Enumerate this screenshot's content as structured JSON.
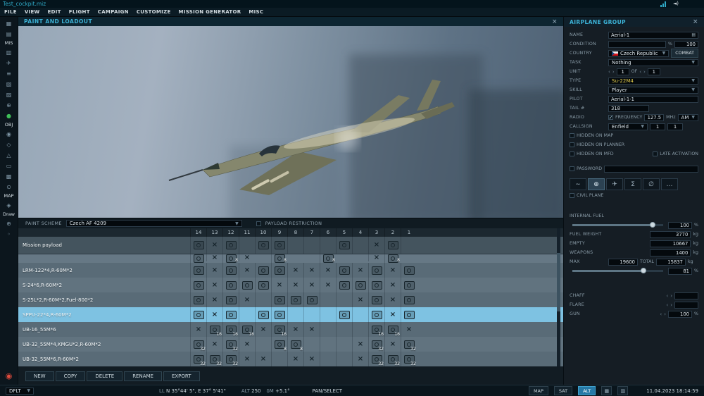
{
  "window": {
    "title": "Test_cockpit.miz"
  },
  "menu": {
    "items": [
      "FILE",
      "VIEW",
      "EDIT",
      "FLIGHT",
      "CAMPAIGN",
      "CUSTOMIZE",
      "MISSION GENERATOR",
      "MISC"
    ]
  },
  "sidebar": {
    "items": [
      {
        "glyph": "▦",
        "name": "open-mission"
      },
      {
        "glyph": "▤",
        "name": "save-mission"
      },
      {
        "label": "MIS"
      },
      {
        "glyph": "▥",
        "name": "briefing"
      },
      {
        "glyph": "✈",
        "name": "aircraft-group"
      },
      {
        "glyph": "≡",
        "name": "mission-options"
      },
      {
        "glyph": "▧",
        "name": "weather"
      },
      {
        "glyph": "▨",
        "name": "rules"
      },
      {
        "glyph": "⊕",
        "name": "add-unit"
      },
      {
        "glyph": "●",
        "color": "green",
        "name": "status"
      },
      {
        "label": "OBJ"
      },
      {
        "glyph": "◉",
        "name": "unit-list"
      },
      {
        "glyph": "◇",
        "name": "static-object"
      },
      {
        "glyph": "△",
        "name": "template"
      },
      {
        "glyph": "▭",
        "name": "trigger-zone"
      },
      {
        "glyph": "▩",
        "name": "grid"
      },
      {
        "glyph": "⊙",
        "name": "circle-tool"
      },
      {
        "label": "MAP"
      },
      {
        "glyph": "◈",
        "name": "map-overlay"
      },
      {
        "label": "Draw"
      },
      {
        "glyph": "⊕",
        "name": "measure-tool"
      },
      {
        "glyph": "◦",
        "name": "misc-tool"
      }
    ],
    "record": {
      "glyph": "◉"
    }
  },
  "paint": {
    "title": "PAINT AND LOADOUT",
    "close": "×",
    "scheme_label": "PAINT SCHEME",
    "scheme_value": "Czech AF 4209",
    "restriction_label": "PAYLOAD RESTRICTION"
  },
  "loadout": {
    "columns": [
      "14",
      "13",
      "12",
      "11",
      "10",
      "9",
      "8",
      "7",
      "6",
      "5",
      "4",
      "3",
      "2",
      "1"
    ],
    "payload_row": {
      "label": "Mission payload",
      "cells": [
        {
          "t": "w"
        },
        {
          "t": "x"
        },
        {
          "t": "w"
        },
        {},
        {
          "t": "w"
        },
        {
          "t": "w"
        },
        {},
        {},
        {},
        {
          "t": "w"
        },
        {},
        {
          "t": "x"
        },
        {
          "t": "w"
        },
        {}
      ]
    },
    "rows": [
      {
        "label": "",
        "clipped": true,
        "cells": [
          {
            "t": "w"
          },
          {
            "t": "x"
          },
          {
            "t": "w",
            "n": "8"
          },
          {
            "t": "x"
          },
          {},
          {
            "t": "w",
            "n": "8"
          },
          {},
          {},
          {
            "t": "w",
            "n": "8"
          },
          {},
          {},
          {
            "t": "x"
          },
          {
            "t": "w",
            "n": "8"
          },
          {}
        ]
      },
      {
        "label": "LRM-122*4,R-60M*2",
        "cells": [
          {
            "t": "w"
          },
          {
            "t": "x"
          },
          {
            "t": "w"
          },
          {
            "t": "x"
          },
          {
            "t": "w"
          },
          {
            "t": "w"
          },
          {
            "t": "x"
          },
          {
            "t": "x"
          },
          {
            "t": "x"
          },
          {
            "t": "w"
          },
          {
            "t": "x"
          },
          {
            "t": "w"
          },
          {
            "t": "x"
          },
          {
            "t": "w"
          }
        ]
      },
      {
        "label": "S-24*6,R-60M*2",
        "cells": [
          {
            "t": "w"
          },
          {
            "t": "x"
          },
          {
            "t": "w"
          },
          {
            "t": "w"
          },
          {
            "t": "w"
          },
          {
            "t": "x"
          },
          {
            "t": "x"
          },
          {
            "t": "x"
          },
          {
            "t": "x"
          },
          {
            "t": "w"
          },
          {
            "t": "w"
          },
          {
            "t": "w"
          },
          {
            "t": "x"
          },
          {
            "t": "w"
          }
        ]
      },
      {
        "label": "S-25L*2,R-60M*2,Fuel-800*2",
        "cells": [
          {
            "t": "w"
          },
          {
            "t": "x"
          },
          {
            "t": "w"
          },
          {
            "t": "x"
          },
          {},
          {
            "t": "w"
          },
          {
            "t": "w"
          },
          {
            "t": "w"
          },
          {},
          {},
          {
            "t": "x"
          },
          {
            "t": "w"
          },
          {
            "t": "x"
          },
          {
            "t": "w"
          }
        ]
      },
      {
        "label": "SPPU-22*4,R-60M*2",
        "selected": true,
        "cells": [
          {
            "t": "w"
          },
          {
            "t": "x"
          },
          {
            "t": "w"
          },
          {},
          {
            "t": "w"
          },
          {
            "t": "w"
          },
          {},
          {},
          {},
          {
            "t": "w"
          },
          {},
          {
            "t": "w"
          },
          {
            "t": "x"
          },
          {
            "t": "w"
          }
        ]
      },
      {
        "label": "UB-16_55M*6",
        "cells": [
          {
            "t": "x"
          },
          {
            "t": "w",
            "n": "16"
          },
          {
            "t": "w",
            "n": "16"
          },
          {
            "t": "w",
            "n": "16"
          },
          {
            "t": "x"
          },
          {
            "t": "w",
            "n": "16"
          },
          {
            "t": "x"
          },
          {
            "t": "x"
          },
          {},
          {},
          {},
          {
            "t": "w",
            "n": "16"
          },
          {
            "t": "w",
            "n": "16"
          },
          {
            "t": "x"
          }
        ]
      },
      {
        "label": "UB-32_55M*4,KMGU*2,R-60M*2",
        "cells": [
          {
            "t": "w",
            "n": "32"
          },
          {
            "t": "x"
          },
          {
            "t": "w",
            "n": "32"
          },
          {
            "t": "x"
          },
          {},
          {
            "t": "w",
            "n": "8"
          },
          {
            "t": "w",
            "n": "8"
          },
          {},
          {},
          {},
          {
            "t": "x"
          },
          {
            "t": "w",
            "n": "32"
          },
          {
            "t": "x"
          },
          {
            "t": "w",
            "n": "32"
          }
        ]
      },
      {
        "label": "UB-32_55M*6,R-60M*2",
        "cells": [
          {
            "t": "w",
            "n": "32"
          },
          {
            "t": "w",
            "n": "32"
          },
          {
            "t": "w",
            "n": "32"
          },
          {
            "t": "x"
          },
          {
            "t": "x"
          },
          {},
          {
            "t": "x"
          },
          {
            "t": "x"
          },
          {},
          {},
          {
            "t": "x"
          },
          {
            "t": "w",
            "n": "32"
          },
          {
            "t": "w",
            "n": "32"
          },
          {
            "t": "w",
            "n": "32"
          }
        ]
      }
    ],
    "buttons": [
      "NEW",
      "COPY",
      "DELETE",
      "RENAME",
      "EXPORT"
    ]
  },
  "group": {
    "title": "AIRPLANE GROUP",
    "close": "×",
    "rows": {
      "name": {
        "label": "NAME",
        "value": "Aerial-1"
      },
      "condition": {
        "label": "CONDITION",
        "pct": "%",
        "value": "100"
      },
      "country": {
        "label": "COUNTRY",
        "value": "Czech Republic",
        "combat": "COMBAT"
      },
      "task": {
        "label": "TASK",
        "value": "Nothing"
      },
      "unit": {
        "label": "UNIT",
        "value": "1",
        "of": "OF",
        "total": "1"
      },
      "type": {
        "label": "TYPE",
        "value": "Su-22M4"
      },
      "skill": {
        "label": "SKILL",
        "value": "Player"
      },
      "pilot": {
        "label": "PILOT",
        "value": "Aerial-1-1"
      },
      "tail": {
        "label": "TAIL #",
        "value": "318"
      },
      "radio": {
        "label": "RADIO",
        "freq_label": "FREQUENCY",
        "freq": "127.5",
        "unit": "MHz",
        "mod": "AM"
      },
      "callsign": {
        "label": "CALLSIGN",
        "value": "Enfield",
        "n1": "1",
        "n2": "1"
      },
      "hidden_map": "HIDDEN ON MAP",
      "hidden_planner": "HIDDEN ON PLANNER",
      "hidden_mfd": "HIDDEN ON MFD",
      "late_activation": "LATE ACTIVATION",
      "password": "PASSWORD",
      "civil": "CIVIL PLANE"
    },
    "tabs": [
      {
        "glyph": "∼",
        "name": "route-tab"
      },
      {
        "glyph": "⊕",
        "name": "loadout-tab",
        "active": true
      },
      {
        "glyph": "✈",
        "name": "aircraft-tab"
      },
      {
        "glyph": "Σ",
        "name": "summary-tab"
      },
      {
        "glyph": "∅",
        "name": "failures-tab"
      },
      {
        "glyph": "…",
        "name": "more-tab"
      }
    ],
    "fuel": {
      "internal_label": "INTERNAL FUEL",
      "internal_value": "100",
      "pct": "%",
      "weight_label": "FUEL WEIGHT",
      "weight": "3770",
      "kg": "kg",
      "empty_label": "EMPTY",
      "empty": "10667",
      "weapons_label": "WEAPONS",
      "weapons": "1400",
      "max_label": "MAX",
      "max": "19600",
      "total_label": "TOTAL",
      "total": "15837",
      "load_value": "81"
    },
    "countermeasures": {
      "chaff_label": "CHAFF",
      "flare_label": "FLARE",
      "gun_label": "GUN",
      "gun_value": "100",
      "gun_pct": "%"
    }
  },
  "statusbar": {
    "mode": "DFLT",
    "ll": "LL",
    "coords": "N 35°44' 5\", E 37° 5'41\"",
    "alt_label": "ALT",
    "alt": "250",
    "decl_label": "δM",
    "decl": "+5.1°",
    "pan": "PAN/SELECT",
    "map": "MAP",
    "sat": "SAT",
    "altb": "ALT",
    "datetime": "11.04.2023 18:14:59"
  }
}
